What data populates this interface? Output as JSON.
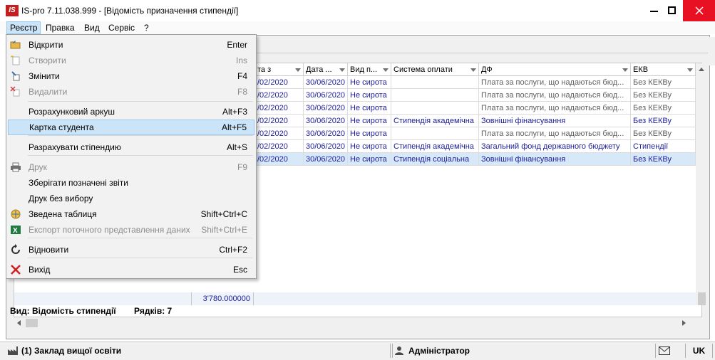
{
  "window": {
    "logo": "IS",
    "title": "IS-pro 7.11.038.999 - [Відомість призначення стипендії]"
  },
  "menubar": {
    "items": [
      {
        "label": "Реєстр"
      },
      {
        "label": "Правка"
      },
      {
        "label": "Вид"
      },
      {
        "label": "Сервіс"
      },
      {
        "label": "?"
      }
    ]
  },
  "dropdown": {
    "items": [
      {
        "label": "Відкрити",
        "shortcut": "Enter",
        "icon": "open-icon",
        "enabled": true
      },
      {
        "label": "Створити",
        "shortcut": "Ins",
        "icon": "create-icon",
        "enabled": false
      },
      {
        "label": "Змінити",
        "shortcut": "F4",
        "icon": "edit-icon",
        "enabled": true
      },
      {
        "label": "Видалити",
        "shortcut": "F8",
        "icon": "delete-icon",
        "enabled": false
      },
      {
        "label": "Розрахунковий аркуш",
        "shortcut": "Alt+F3",
        "icon": "",
        "enabled": true
      },
      {
        "label": "Картка студента",
        "shortcut": "Alt+F5",
        "icon": "",
        "enabled": true,
        "highlighted": true
      },
      {
        "label": "Разрахувати стіпендию",
        "shortcut": "Alt+S",
        "icon": "",
        "enabled": true
      },
      {
        "label": "Друк",
        "shortcut": "F9",
        "icon": "print-icon",
        "enabled": false
      },
      {
        "label": "Зберігати позначені звіти",
        "shortcut": "",
        "icon": "",
        "enabled": true
      },
      {
        "label": "Друк без вибору",
        "shortcut": "",
        "icon": "",
        "enabled": true
      },
      {
        "label": "Зведена таблиця",
        "shortcut": "Shift+Ctrl+C",
        "icon": "pivot-table-icon",
        "enabled": true
      },
      {
        "label": "Експорт поточного представлення даних",
        "shortcut": "Shift+Ctrl+E",
        "icon": "excel-icon",
        "enabled": false
      },
      {
        "label": "Відновити",
        "shortcut": "Ctrl+F2",
        "icon": "refresh-icon",
        "enabled": true
      },
      {
        "label": "Вихід",
        "shortcut": "Esc",
        "icon": "exit-icon",
        "enabled": true
      }
    ]
  },
  "grid": {
    "columns": [
      {
        "label": "та з"
      },
      {
        "label": "Дата ..."
      },
      {
        "label": "Вид п..."
      },
      {
        "label": "Система оплати"
      },
      {
        "label": "ДФ"
      },
      {
        "label": "ЕКВ"
      }
    ],
    "rows": [
      {
        "date_from": "/02/2020",
        "date_to": "30/06/2020",
        "kind": "Не сирота",
        "payment": "",
        "df": "Плата за послуги, що надаються бюд...",
        "ekv": "Без КЕКВу",
        "style": "gray"
      },
      {
        "date_from": "/02/2020",
        "date_to": "30/06/2020",
        "kind": "Не сирота",
        "payment": "",
        "df": "Плата за послуги, що надаються бюд...",
        "ekv": "Без КЕКВу",
        "style": "gray"
      },
      {
        "date_from": "/02/2020",
        "date_to": "30/06/2020",
        "kind": "Не сирота",
        "payment": "",
        "df": "Плата за послуги, що надаються бюд...",
        "ekv": "Без КЕКВу",
        "style": "gray"
      },
      {
        "date_from": "/02/2020",
        "date_to": "30/06/2020",
        "kind": "Не сирота",
        "payment": "Стипендія академічна",
        "df": "Зовнішні фінансування",
        "ekv": "Без КЕКВу",
        "style": "blue"
      },
      {
        "date_from": "/02/2020",
        "date_to": "30/06/2020",
        "kind": "Не сирота",
        "payment": "",
        "df": "Плата за послуги, що надаються бюд...",
        "ekv": "Без КЕКВу",
        "style": "gray"
      },
      {
        "date_from": "/02/2020",
        "date_to": "30/06/2020",
        "kind": "Не сирота",
        "payment": "Стипендія академічна",
        "df": "Загальний фонд державного бюджету",
        "ekv": "Стипендії",
        "style": "blue"
      },
      {
        "date_from": "/02/2020",
        "date_to": "30/06/2020",
        "kind": "Не сирота",
        "payment": "Стипендія соціальна",
        "df": "Зовнішні фінансування",
        "ekv": "Без КЕКВу",
        "style": "blue",
        "selected": true
      }
    ],
    "total": "3'780.000000"
  },
  "footer": {
    "view": "Вид: Відомість стипендії",
    "rows": "Рядків: 7"
  },
  "statusbar": {
    "org": "(1) Заклад вищої освіти",
    "user": "Адміністратор",
    "lang": "UK"
  },
  "colors": {
    "highlight": "#cce4f7",
    "close_button": "#e81123",
    "link_text": "#1c1c9c"
  }
}
